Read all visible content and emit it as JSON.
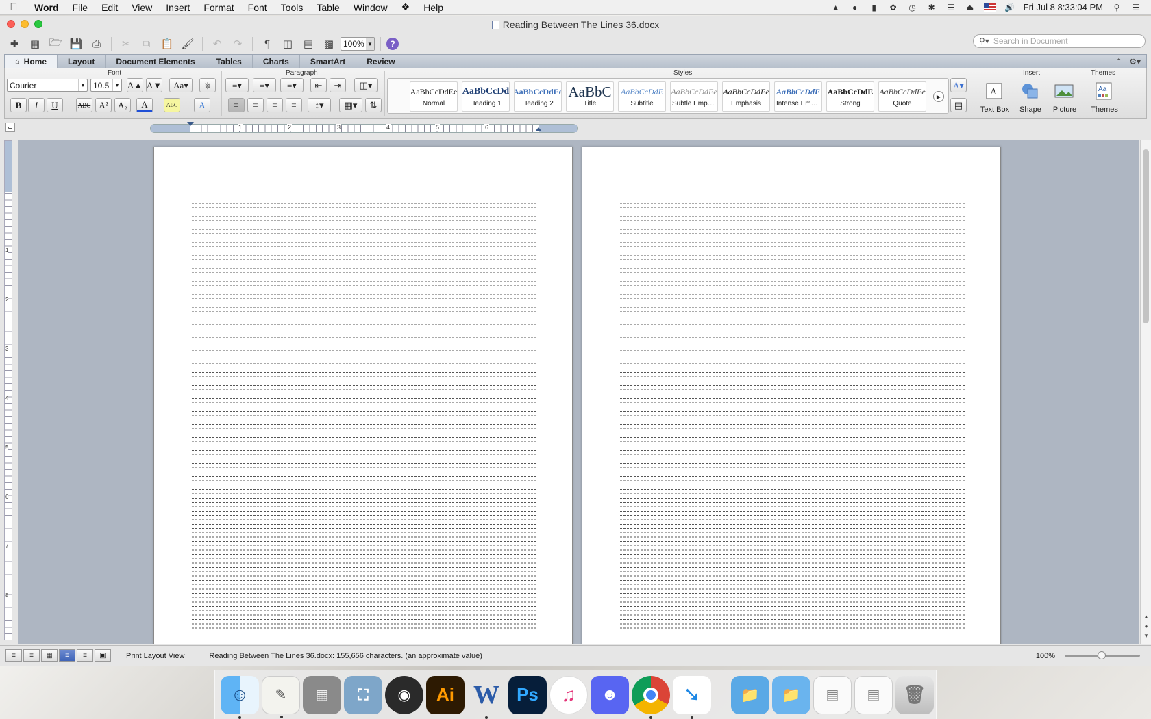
{
  "menubar": {
    "app": "Word",
    "items": [
      "File",
      "Edit",
      "View",
      "Insert",
      "Format",
      "Font",
      "Tools",
      "Table",
      "Window",
      "Help"
    ],
    "clock": "Fri Jul 8  8:33:04 PM"
  },
  "window": {
    "title": "Reading Between The Lines 36.docx"
  },
  "toolbar": {
    "zoom": "100%",
    "search_placeholder": "Search in Document"
  },
  "ribbon": {
    "tabs": [
      "Home",
      "Layout",
      "Document Elements",
      "Tables",
      "Charts",
      "SmartArt",
      "Review"
    ],
    "active_tab": "Home",
    "groups": {
      "font": "Font",
      "paragraph": "Paragraph",
      "styles": "Styles",
      "insert": "Insert",
      "themes": "Themes"
    },
    "font_name": "Courier",
    "font_size": "10.5",
    "font_buttons": [
      "B",
      "I",
      "U",
      "ABC",
      "A²",
      "A₂"
    ],
    "styles": [
      {
        "preview": "AaBbCcDdEe",
        "name": "Normal"
      },
      {
        "preview": "AaBbCcDd",
        "name": "Heading 1"
      },
      {
        "preview": "AaBbCcDdEe",
        "name": "Heading 2"
      },
      {
        "preview": "AaBbC",
        "name": "Title"
      },
      {
        "preview": "AaBbCcDdE",
        "name": "Subtitle"
      },
      {
        "preview": "AaBbCcDdEe",
        "name": "Subtle Emph..."
      },
      {
        "preview": "AaBbCcDdEe",
        "name": "Emphasis"
      },
      {
        "preview": "AaBbCcDdE",
        "name": "Intense Emp..."
      },
      {
        "preview": "AaBbCcDdE",
        "name": "Strong"
      },
      {
        "preview": "AaBbCcDdEe",
        "name": "Quote"
      }
    ],
    "insert_buttons": [
      "Text Box",
      "Shape",
      "Picture"
    ],
    "themes_button": "Themes"
  },
  "ruler": {
    "numbers": [
      "1",
      "2",
      "3",
      "4",
      "5",
      "6"
    ]
  },
  "vruler": {
    "numbers": [
      "1",
      "2",
      "3",
      "4",
      "5",
      "6",
      "7",
      "8"
    ]
  },
  "statusbar": {
    "view": "Print Layout View",
    "info": "Reading Between The Lines 36.docx: 155,656 characters. (an approximate value)",
    "zoom": "100%"
  },
  "dock": {
    "apps": [
      "Finder",
      "TextEdit",
      "Calculator",
      "Preview",
      "OBS",
      "Illustrator",
      "Word",
      "Photoshop",
      "iTunes",
      "Discord",
      "Chrome",
      "Zotero",
      "Folder",
      "Folder",
      "Document",
      "Document",
      "Trash"
    ],
    "labels": {
      "illustrator": "Ai",
      "word": "W",
      "photoshop": "Ps"
    }
  },
  "colors": {
    "doc_background": "#aeb6c2",
    "accent": "#3e63b7"
  }
}
